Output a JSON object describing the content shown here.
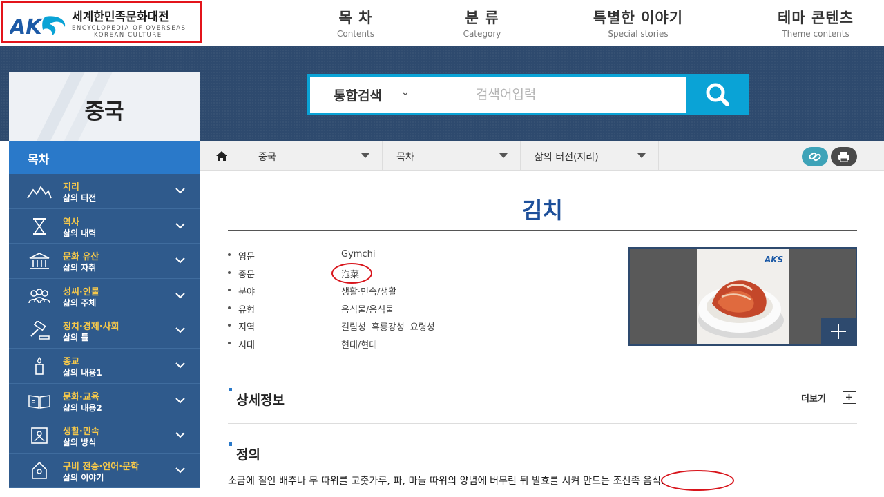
{
  "logo": {
    "mark": "AK",
    "title_kr": "세계한민족문화대전",
    "title_en_1": "ENCYCLOPEDIA OF OVERSEAS",
    "title_en_2": "KOREAN CULTURE"
  },
  "nav": [
    {
      "kr": "목 차",
      "en": "Contents"
    },
    {
      "kr": "분 류",
      "en": "Category"
    },
    {
      "kr": "특별한 이야기",
      "en": "Special stories"
    },
    {
      "kr": "테마 콘텐츠",
      "en": "Theme contents"
    }
  ],
  "country": "중국",
  "search": {
    "type_label": "통합검색",
    "placeholder": "검색어입력",
    "button_icon": "search-icon"
  },
  "sidebar": {
    "heading": "목차",
    "items": [
      {
        "title": "지리",
        "sub": "삶의 터전",
        "icon": "mountain-icon"
      },
      {
        "title": "역사",
        "sub": "삶의 내력",
        "icon": "hourglass-icon"
      },
      {
        "title": "문화 유산",
        "sub": "삶의 자취",
        "icon": "temple-icon"
      },
      {
        "title": "성씨·인물",
        "sub": "삶의 주체",
        "icon": "people-icon"
      },
      {
        "title": "정치·경제·사회",
        "sub": "삶의 틀",
        "icon": "gavel-icon"
      },
      {
        "title": "종교",
        "sub": "삶의 내용1",
        "icon": "candle-icon"
      },
      {
        "title": "문화·교육",
        "sub": "삶의 내용2",
        "icon": "book-icon"
      },
      {
        "title": "생활·민속",
        "sub": "삶의 방식",
        "icon": "frame-icon"
      },
      {
        "title": "구비 전승·언어·문학",
        "sub": "삶의 이야기",
        "icon": "scroll-icon"
      }
    ]
  },
  "breadcrumb": {
    "home_icon": "home-icon",
    "items": [
      "중국",
      "목차",
      "삶의 터전(지리)"
    ],
    "link_icon": "link-icon",
    "print_icon": "print-icon"
  },
  "article": {
    "title": "김치",
    "info": [
      {
        "label": "영문",
        "value": "Gymchi"
      },
      {
        "label": "중문",
        "value": "泡菜"
      },
      {
        "label": "분야",
        "value": "생활·민속/생활"
      },
      {
        "label": "유형",
        "value": "음식물/음식물"
      },
      {
        "label": "지역",
        "links": [
          "길림성",
          "흑룡강성",
          "요령성"
        ]
      },
      {
        "label": "시대",
        "value": "현대/현대"
      }
    ],
    "photo_logo": "AKS",
    "sections": {
      "detail": "상세정보",
      "more": "더보기",
      "definition_title": "정의",
      "definition_text": "소금에 절인 배추나 무 따위를 고춧가루, 파, 마늘 따위의 양념에 버무린 뒤 발효를 시켜 만드는 조선족 음식."
    }
  },
  "colors": {
    "header_blue": "#2e4a6e",
    "accent_blue": "#2a79c9",
    "search_cyan": "#0aa3d6",
    "menu_gold": "#f5c84b",
    "annotation_red": "#d8141b"
  }
}
